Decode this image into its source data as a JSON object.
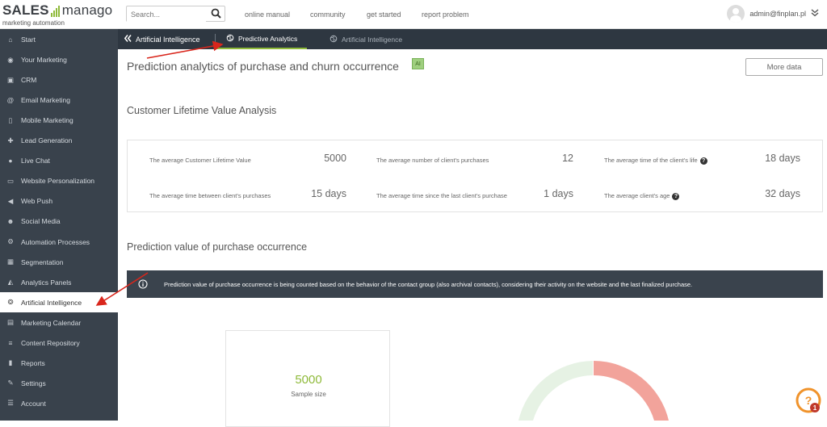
{
  "topbar": {
    "logo_main_left": "SALES",
    "logo_main_right": "manago",
    "logo_sub": "marketing automation",
    "search_placeholder": "Search...",
    "links": [
      "online manual",
      "community",
      "get started",
      "report problem"
    ],
    "user_email": "admin@finplan.pl"
  },
  "sidebar": {
    "items": [
      {
        "label": "Start",
        "icon": "home-icon"
      },
      {
        "label": "Your Marketing",
        "icon": "eye-icon"
      },
      {
        "label": "CRM",
        "icon": "id-card-icon"
      },
      {
        "label": "Email Marketing",
        "icon": "at-icon"
      },
      {
        "label": "Mobile Marketing",
        "icon": "mobile-icon"
      },
      {
        "label": "Lead Generation",
        "icon": "user-plus-icon"
      },
      {
        "label": "Live Chat",
        "icon": "chat-icon"
      },
      {
        "label": "Website Personalization",
        "icon": "browser-icon"
      },
      {
        "label": "Web Push",
        "icon": "bullhorn-icon"
      },
      {
        "label": "Social Media",
        "icon": "users-icon"
      },
      {
        "label": "Automation Processes",
        "icon": "cogs-icon"
      },
      {
        "label": "Segmentation",
        "icon": "grid-icon"
      },
      {
        "label": "Analytics Panels",
        "icon": "area-chart-icon"
      },
      {
        "label": "Artificial Intelligence",
        "icon": "brain-icon",
        "active": true
      },
      {
        "label": "Marketing Calendar",
        "icon": "calendar-icon"
      },
      {
        "label": "Content Repository",
        "icon": "database-icon"
      },
      {
        "label": "Reports",
        "icon": "file-icon"
      },
      {
        "label": "Settings",
        "icon": "wrench-icon"
      },
      {
        "label": "Account",
        "icon": "sliders-icon"
      }
    ]
  },
  "subnav": {
    "crumb": "Artificial Intelligence",
    "tabs": [
      {
        "label": "Predictive Analytics",
        "active": true
      },
      {
        "label": "Artificial Intelligence",
        "active": false
      }
    ]
  },
  "main": {
    "page_title": "Prediction analytics of purchase and churn occurrence",
    "ai_badge": "AI",
    "more_data_button": "More data",
    "clv_section_title": "Customer Lifetime Value Analysis",
    "clv_stats": [
      {
        "label": "The average Customer Lifetime Value",
        "value": "5000",
        "help": false
      },
      {
        "label": "The average number of client's purchases",
        "value": "12",
        "help": false
      },
      {
        "label": "The average time of the client's life",
        "value": "18 days",
        "help": true
      },
      {
        "label": "The average time between client's purchases",
        "value": "15 days",
        "help": false
      },
      {
        "label": "The average time since the last client's purchase",
        "value": "1 days",
        "help": false
      },
      {
        "label": "The average client's age",
        "value": "32 days",
        "help": true
      }
    ],
    "prediction_section_title": "Prediction value of purchase occurrence",
    "info_text": "Prediction value of purchase occurrence is being counted based on the behavior of the contact group (also archival contacts), considering their activity on the website and the last finalized purchase.",
    "sample_value": "5000",
    "sample_label": "Sample size"
  },
  "help_badge_count": "1",
  "colors": {
    "accent_green": "#8fba3a",
    "sidebar_bg": "#39424c",
    "subnav_bg": "#2e3741",
    "annotation_red": "#d9261c",
    "donut_red": "#f2a39b",
    "donut_green": "#e6f2e4",
    "help_orange": "#f0932b"
  }
}
